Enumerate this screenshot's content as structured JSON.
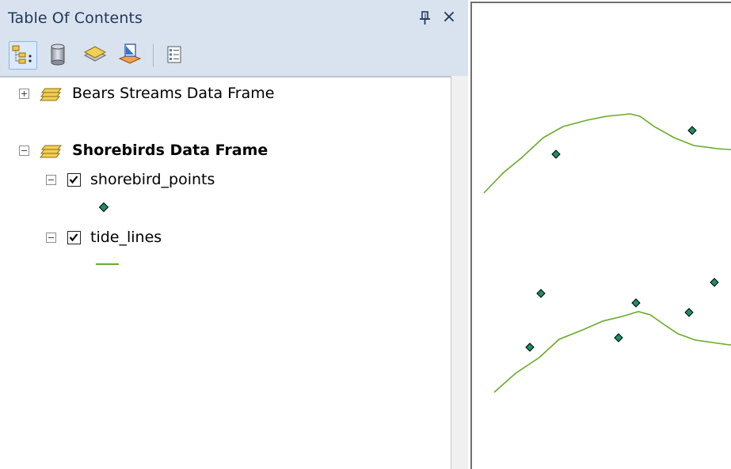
{
  "toc": {
    "title": "Table Of Contents",
    "pin_icon": "pin-icon",
    "close_glyph": "×",
    "toolbar": [
      {
        "name": "list-by-drawing-order-button",
        "icon": "drawing-order-icon",
        "active": true
      },
      {
        "name": "list-by-source-button",
        "icon": "database-icon",
        "active": false
      },
      {
        "name": "list-by-visibility-button",
        "icon": "layers-icon",
        "active": false
      },
      {
        "name": "list-by-selection-button",
        "icon": "selection-icon",
        "active": false
      },
      {
        "name": "options-button",
        "icon": "options-icon",
        "active": false
      }
    ],
    "data_frames": [
      {
        "label": "Bears Streams Data Frame",
        "expanded": false,
        "bold": false
      },
      {
        "label": "Shorebirds Data Frame",
        "expanded": true,
        "bold": true,
        "layers": [
          {
            "label": "shorebird_points",
            "checked": true,
            "symbol": "point",
            "symbol_color": "#1a8f6a"
          },
          {
            "label": "tide_lines",
            "checked": true,
            "symbol": "line",
            "symbol_color": "#6aaa28"
          }
        ]
      }
    ]
  },
  "colors": {
    "header_bg": "#d9e2ef",
    "title_text": "#1e395b",
    "point_fill": "#1a8f6a",
    "line_stroke": "#6aaa28"
  }
}
